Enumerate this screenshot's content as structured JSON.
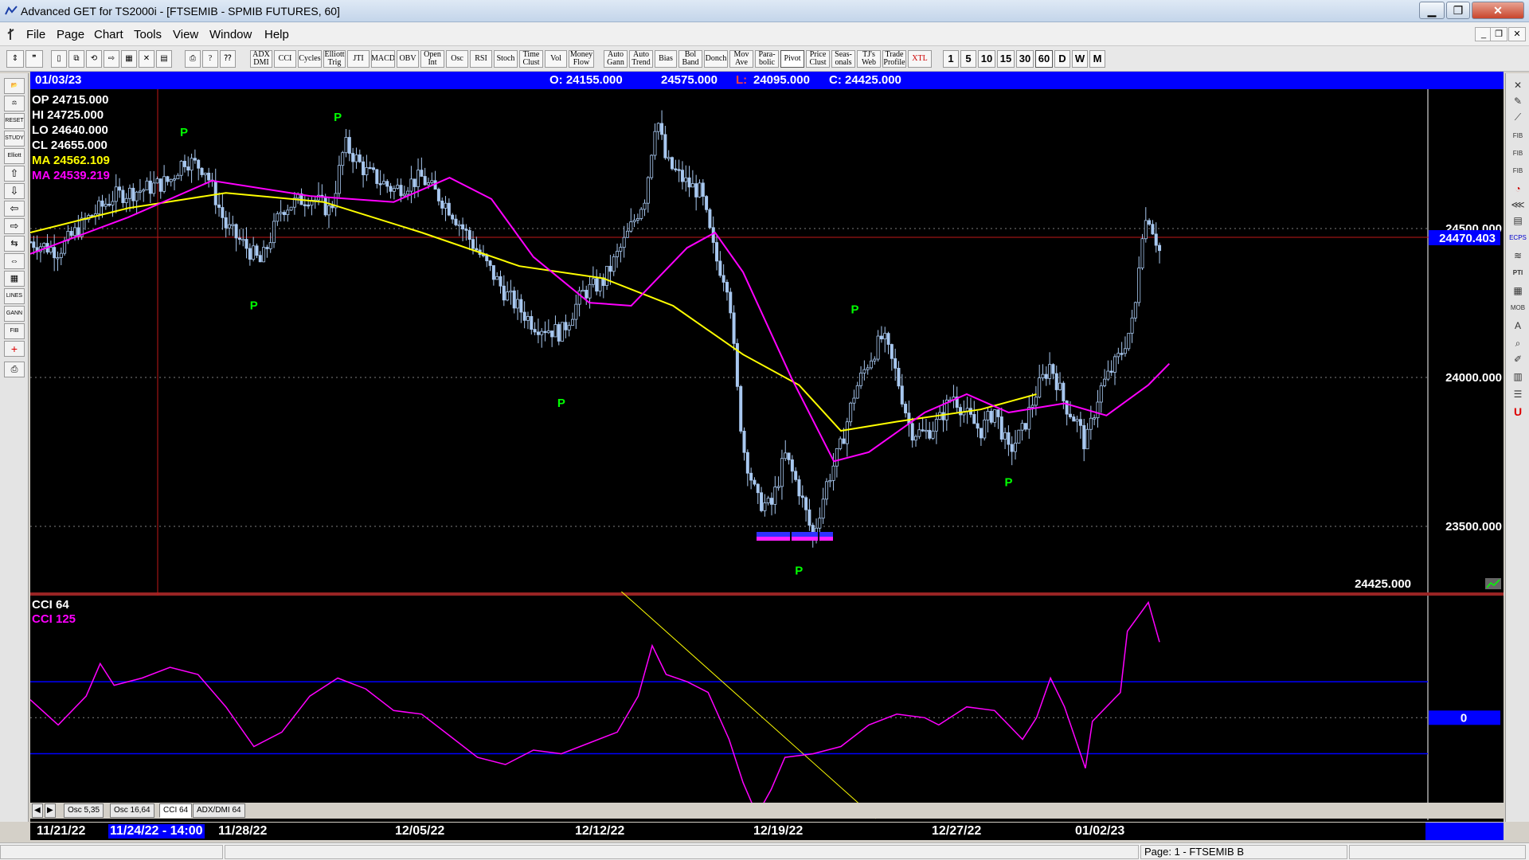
{
  "window": {
    "title": "Advanced GET for TS2000i - [FTSEMIB - SPMIB FUTURES, 60]",
    "minimize": "▁",
    "restore": "❐",
    "close": "✕"
  },
  "menu": {
    "items": [
      "File",
      "Page",
      "Chart",
      "Tools",
      "View",
      "Window",
      "Help"
    ]
  },
  "toolbar": {
    "study_buttons": [
      "ADX DMI",
      "CCI",
      "Cycles",
      "Elliott Trig",
      "JTI",
      "MACD",
      "OBV",
      "Open Int",
      "Osc",
      "RSI",
      "Stoch",
      "Time Clust",
      "Vol",
      "Money Flow",
      "Auto Gann",
      "Auto Trend",
      "Bias",
      "Bol Band",
      "Donch",
      "Mov Ave",
      "Para-bolic",
      "Pivot",
      "Price Clust",
      "Seas-onals",
      "TJ's Web",
      "Trade Profile",
      "XTL"
    ],
    "intervals": [
      "1",
      "5",
      "10",
      "15",
      "30",
      "60",
      "D",
      "W",
      "M"
    ],
    "active_interval": "60"
  },
  "left_tools": [
    "RESET",
    "STUDY",
    "Elliott",
    "LINES",
    "GANN",
    "FIB"
  ],
  "right_tools": [
    "FIB RET",
    "FIB EXT",
    "FIB TIME",
    "ECPS",
    "PTI",
    "MOB"
  ],
  "infobar": {
    "date": "01/03/23",
    "open": "O: 24155.000",
    "high": "24575.000",
    "low_label": "L:",
    "low": "24095.000",
    "close": "C: 24425.000"
  },
  "readout": {
    "op": "OP  24715.000",
    "hi": "HI   24725.000",
    "lo": "LO  24640.000",
    "cl": "CL  24655.000",
    "ma1": "MA  24562.109",
    "ma2": "MA  24539.219"
  },
  "price_axis": {
    "labels": [
      "24500.000",
      "24000.000",
      "23500.000"
    ],
    "current_price": "24470.403",
    "last_close": "24425.000"
  },
  "oscillator": {
    "name1": "CCI 64",
    "name2": "CCI  125",
    "zero": "0"
  },
  "tabs": [
    "Osc 5,35",
    "Osc 16,64",
    "CCI 64",
    "ADX/DMI 64"
  ],
  "active_tab": "CCI 64",
  "dates": {
    "labels": [
      "11/21/22",
      "11/24/22 - 14:00",
      "11/28/22",
      "12/05/22",
      "12/12/22",
      "12/19/22",
      "12/27/22",
      "01/02/23"
    ],
    "selected": "11/24/22 - 14:00"
  },
  "status": {
    "page": "Page: 1 - FTSEMIB B"
  },
  "colors": {
    "candle": "#a8c8f0",
    "ma_yellow": "#ffff00",
    "ma_magenta": "#ff00ff",
    "pivot": "#00ff00",
    "hline": "#0000ff"
  },
  "chart_data": {
    "type": "candlestick",
    "symbol": "FTSEMIB - SPMIB FUTURES",
    "interval": "60",
    "ylim": [
      23300,
      24950
    ],
    "x_range": [
      "11/21/22",
      "01/03/23"
    ],
    "price_levels": [
      24500,
      24000,
      23500
    ],
    "current_price": 24470.403,
    "pivots": [
      {
        "label": "P",
        "type": "high",
        "x": 0.11,
        "price": 24780
      },
      {
        "label": "P",
        "type": "low",
        "x": 0.16,
        "price": 24270
      },
      {
        "label": "P",
        "type": "high",
        "x": 0.22,
        "price": 24830
      },
      {
        "label": "P",
        "type": "low",
        "x": 0.38,
        "price": 23950
      },
      {
        "label": "P",
        "type": "low",
        "x": 0.55,
        "price": 23400
      },
      {
        "label": "P",
        "type": "high",
        "x": 0.59,
        "price": 24200
      },
      {
        "label": "P",
        "type": "low",
        "x": 0.7,
        "price": 23690
      }
    ],
    "price_path": [
      {
        "x": 0.0,
        "y": 24450
      },
      {
        "x": 0.02,
        "y": 24420
      },
      {
        "x": 0.04,
        "y": 24520
      },
      {
        "x": 0.06,
        "y": 24600
      },
      {
        "x": 0.08,
        "y": 24620
      },
      {
        "x": 0.1,
        "y": 24650
      },
      {
        "x": 0.11,
        "y": 24720
      },
      {
        "x": 0.125,
        "y": 24690
      },
      {
        "x": 0.14,
        "y": 24500
      },
      {
        "x": 0.155,
        "y": 24430
      },
      {
        "x": 0.165,
        "y": 24380
      },
      {
        "x": 0.18,
        "y": 24560
      },
      {
        "x": 0.2,
        "y": 24600
      },
      {
        "x": 0.215,
        "y": 24550
      },
      {
        "x": 0.225,
        "y": 24770
      },
      {
        "x": 0.24,
        "y": 24680
      },
      {
        "x": 0.26,
        "y": 24620
      },
      {
        "x": 0.28,
        "y": 24660
      },
      {
        "x": 0.3,
        "y": 24560
      },
      {
        "x": 0.32,
        "y": 24420
      },
      {
        "x": 0.34,
        "y": 24280
      },
      {
        "x": 0.36,
        "y": 24180
      },
      {
        "x": 0.38,
        "y": 24150
      },
      {
        "x": 0.395,
        "y": 24280
      },
      {
        "x": 0.41,
        "y": 24320
      },
      {
        "x": 0.425,
        "y": 24450
      },
      {
        "x": 0.44,
        "y": 24600
      },
      {
        "x": 0.448,
        "y": 24870
      },
      {
        "x": 0.455,
        "y": 24710
      },
      {
        "x": 0.47,
        "y": 24640
      },
      {
        "x": 0.48,
        "y": 24610
      },
      {
        "x": 0.49,
        "y": 24400
      },
      {
        "x": 0.5,
        "y": 24300
      },
      {
        "x": 0.505,
        "y": 24000
      },
      {
        "x": 0.51,
        "y": 23780
      },
      {
        "x": 0.52,
        "y": 23600
      },
      {
        "x": 0.53,
        "y": 23580
      },
      {
        "x": 0.54,
        "y": 23750
      },
      {
        "x": 0.55,
        "y": 23640
      },
      {
        "x": 0.56,
        "y": 23480
      },
      {
        "x": 0.57,
        "y": 23660
      },
      {
        "x": 0.58,
        "y": 23780
      },
      {
        "x": 0.59,
        "y": 23960
      },
      {
        "x": 0.6,
        "y": 24060
      },
      {
        "x": 0.61,
        "y": 24140
      },
      {
        "x": 0.62,
        "y": 24010
      },
      {
        "x": 0.63,
        "y": 23830
      },
      {
        "x": 0.64,
        "y": 23820
      },
      {
        "x": 0.65,
        "y": 23860
      },
      {
        "x": 0.66,
        "y": 23950
      },
      {
        "x": 0.67,
        "y": 23880
      },
      {
        "x": 0.68,
        "y": 23830
      },
      {
        "x": 0.69,
        "y": 23900
      },
      {
        "x": 0.7,
        "y": 23760
      },
      {
        "x": 0.71,
        "y": 23830
      },
      {
        "x": 0.72,
        "y": 23960
      },
      {
        "x": 0.73,
        "y": 24050
      },
      {
        "x": 0.74,
        "y": 23920
      },
      {
        "x": 0.75,
        "y": 23850
      },
      {
        "x": 0.755,
        "y": 23780
      },
      {
        "x": 0.765,
        "y": 23960
      },
      {
        "x": 0.78,
        "y": 24080
      },
      {
        "x": 0.79,
        "y": 24200
      },
      {
        "x": 0.795,
        "y": 24480
      },
      {
        "x": 0.8,
        "y": 24540
      },
      {
        "x": 0.808,
        "y": 24420
      }
    ],
    "ma_yellow": [
      {
        "x": 0.0,
        "y": 24480
      },
      {
        "x": 0.07,
        "y": 24560
      },
      {
        "x": 0.14,
        "y": 24610
      },
      {
        "x": 0.21,
        "y": 24580
      },
      {
        "x": 0.28,
        "y": 24480
      },
      {
        "x": 0.35,
        "y": 24370
      },
      {
        "x": 0.41,
        "y": 24330
      },
      {
        "x": 0.46,
        "y": 24240
      },
      {
        "x": 0.51,
        "y": 24080
      },
      {
        "x": 0.55,
        "y": 23980
      },
      {
        "x": 0.58,
        "y": 23830
      },
      {
        "x": 0.62,
        "y": 23860
      },
      {
        "x": 0.68,
        "y": 23900
      },
      {
        "x": 0.72,
        "y": 23950
      }
    ],
    "ma_magenta": [
      {
        "x": 0.0,
        "y": 24410
      },
      {
        "x": 0.07,
        "y": 24530
      },
      {
        "x": 0.13,
        "y": 24650
      },
      {
        "x": 0.2,
        "y": 24600
      },
      {
        "x": 0.26,
        "y": 24580
      },
      {
        "x": 0.3,
        "y": 24660
      },
      {
        "x": 0.33,
        "y": 24590
      },
      {
        "x": 0.36,
        "y": 24400
      },
      {
        "x": 0.4,
        "y": 24250
      },
      {
        "x": 0.43,
        "y": 24240
      },
      {
        "x": 0.47,
        "y": 24430
      },
      {
        "x": 0.49,
        "y": 24480
      },
      {
        "x": 0.51,
        "y": 24350
      },
      {
        "x": 0.545,
        "y": 24000
      },
      {
        "x": 0.575,
        "y": 23730
      },
      {
        "x": 0.6,
        "y": 23760
      },
      {
        "x": 0.64,
        "y": 23890
      },
      {
        "x": 0.67,
        "y": 23950
      },
      {
        "x": 0.7,
        "y": 23890
      },
      {
        "x": 0.74,
        "y": 23920
      },
      {
        "x": 0.77,
        "y": 23880
      },
      {
        "x": 0.8,
        "y": 23980
      },
      {
        "x": 0.815,
        "y": 24050
      }
    ],
    "cci_path": [
      {
        "x": 0.0,
        "y": 50
      },
      {
        "x": 0.02,
        "y": -20
      },
      {
        "x": 0.04,
        "y": 60
      },
      {
        "x": 0.05,
        "y": 150
      },
      {
        "x": 0.06,
        "y": 90
      },
      {
        "x": 0.08,
        "y": 110
      },
      {
        "x": 0.1,
        "y": 140
      },
      {
        "x": 0.12,
        "y": 120
      },
      {
        "x": 0.14,
        "y": 30
      },
      {
        "x": 0.16,
        "y": -80
      },
      {
        "x": 0.18,
        "y": -40
      },
      {
        "x": 0.2,
        "y": 60
      },
      {
        "x": 0.22,
        "y": 110
      },
      {
        "x": 0.24,
        "y": 80
      },
      {
        "x": 0.26,
        "y": 20
      },
      {
        "x": 0.28,
        "y": 10
      },
      {
        "x": 0.3,
        "y": -50
      },
      {
        "x": 0.32,
        "y": -110
      },
      {
        "x": 0.34,
        "y": -130
      },
      {
        "x": 0.36,
        "y": -90
      },
      {
        "x": 0.38,
        "y": -100
      },
      {
        "x": 0.4,
        "y": -70
      },
      {
        "x": 0.42,
        "y": -40
      },
      {
        "x": 0.435,
        "y": 60
      },
      {
        "x": 0.445,
        "y": 200
      },
      {
        "x": 0.455,
        "y": 120
      },
      {
        "x": 0.47,
        "y": 100
      },
      {
        "x": 0.485,
        "y": 70
      },
      {
        "x": 0.5,
        "y": -60
      },
      {
        "x": 0.51,
        "y": -180
      },
      {
        "x": 0.52,
        "y": -270
      },
      {
        "x": 0.53,
        "y": -200
      },
      {
        "x": 0.54,
        "y": -110
      },
      {
        "x": 0.56,
        "y": -100
      },
      {
        "x": 0.58,
        "y": -80
      },
      {
        "x": 0.6,
        "y": -20
      },
      {
        "x": 0.62,
        "y": 10
      },
      {
        "x": 0.64,
        "y": 0
      },
      {
        "x": 0.65,
        "y": -20
      },
      {
        "x": 0.67,
        "y": 30
      },
      {
        "x": 0.69,
        "y": 20
      },
      {
        "x": 0.71,
        "y": -60
      },
      {
        "x": 0.72,
        "y": 0
      },
      {
        "x": 0.73,
        "y": 110
      },
      {
        "x": 0.74,
        "y": 30
      },
      {
        "x": 0.755,
        "y": -140
      },
      {
        "x": 0.76,
        "y": -10
      },
      {
        "x": 0.78,
        "y": 70
      },
      {
        "x": 0.785,
        "y": 240
      },
      {
        "x": 0.8,
        "y": 320
      },
      {
        "x": 0.808,
        "y": 210
      }
    ],
    "cci_levels": [
      100,
      0,
      -100
    ],
    "cci_ylim": [
      -280,
      330
    ],
    "trendline": [
      {
        "x": 0.423,
        "y": 350
      },
      {
        "x": 0.605,
        "y": -280
      }
    ]
  }
}
